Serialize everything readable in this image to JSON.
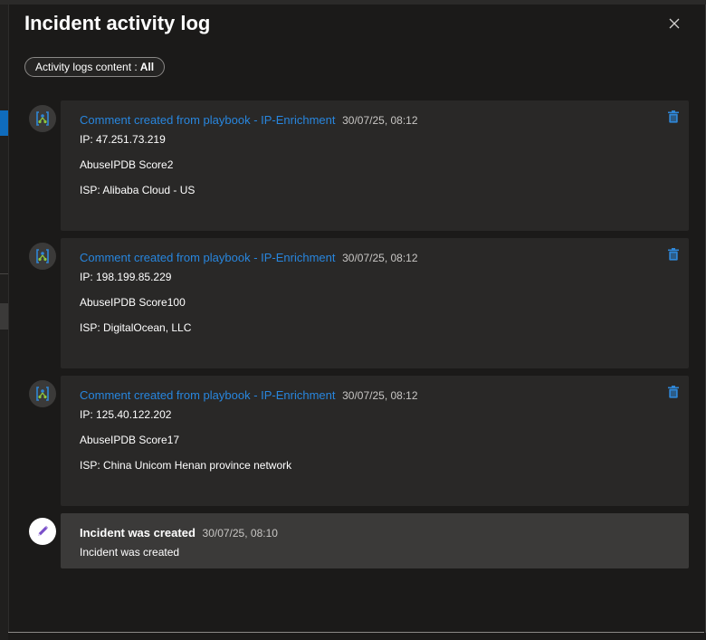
{
  "header": {
    "title": "Incident activity log"
  },
  "filter": {
    "label": "Activity logs content :",
    "value": "All"
  },
  "entries": [
    {
      "title": "Comment created from playbook - IP-Enrichment",
      "time": "30/07/25, 08:12",
      "lines": [
        "IP: 47.251.73.219",
        "AbuseIPDB Score2",
        "ISP: Alibaba Cloud - US"
      ],
      "avatar_icon": "playbook-logic-app-icon",
      "action_icon": "trash-icon"
    },
    {
      "title": "Comment created from playbook - IP-Enrichment",
      "time": "30/07/25, 08:12",
      "lines": [
        "IP: 198.199.85.229",
        "AbuseIPDB Score100",
        "ISP: DigitalOcean, LLC"
      ],
      "avatar_icon": "playbook-logic-app-icon",
      "action_icon": "trash-icon"
    },
    {
      "title": "Comment created from playbook - IP-Enrichment",
      "time": "30/07/25, 08:12",
      "lines": [
        "IP: 125.40.122.202",
        "AbuseIPDB Score17",
        "ISP: China Unicom Henan province network"
      ],
      "avatar_icon": "playbook-logic-app-icon",
      "action_icon": "trash-icon"
    }
  ],
  "created": {
    "title": "Incident was created",
    "time": "30/07/25, 08:10",
    "body": "Incident was created",
    "avatar_icon": "pencil-icon"
  },
  "colors": {
    "link": "#2886de",
    "icon_blue": "#2f86d6",
    "panel_bg": "#1b1a19",
    "card_bg": "#292827",
    "pencil": "#7a4fc9"
  }
}
